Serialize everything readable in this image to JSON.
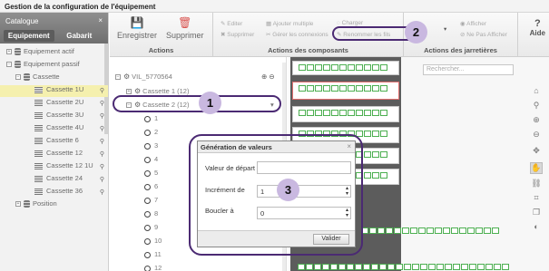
{
  "window": {
    "title": "Gestion de la configuration de l'équipement"
  },
  "catalogue": {
    "title": "Catalogue",
    "close": "×",
    "tabs": [
      "Equipement",
      "Gabarit"
    ],
    "items": [
      {
        "label": "Equipement actif",
        "level": 0
      },
      {
        "label": "Equipement passif",
        "level": 0
      },
      {
        "label": "Cassette",
        "level": 1
      },
      {
        "label": "Cassette 1U",
        "level": 2,
        "selected": true
      },
      {
        "label": "Cassette 2U",
        "level": 2
      },
      {
        "label": "Cassette 3U",
        "level": 2
      },
      {
        "label": "Cassette 4U",
        "level": 2
      },
      {
        "label": "Cassette 6",
        "level": 2
      },
      {
        "label": "Cassette 12",
        "level": 2
      },
      {
        "label": "Cassette 12 1U",
        "level": 2
      },
      {
        "label": "Cassette 24",
        "level": 2
      },
      {
        "label": "Cassette 36",
        "level": 2
      },
      {
        "label": "Position",
        "level": 1
      }
    ]
  },
  "toolbar": {
    "save": "Enregistrer",
    "delete": "Supprimer",
    "actions_title": "Actions",
    "edit": "Editer",
    "delete_small": "Supprimer",
    "add_multiple": "Ajouter multiple",
    "manage_connections": "Gérer les connexions",
    "load": "Charger",
    "rename": "Renommer les fils",
    "components_title": "Actions des composants",
    "show": "Afficher",
    "hide": "Ne Pas Afficher",
    "jumpers_title": "Actions des jarretières",
    "help": "Aide"
  },
  "tree": {
    "root": "VIL_5770564",
    "cassette1": "Cassette 1 (12)",
    "cassette2": "Cassette 2 (12)",
    "ports": [
      "1",
      "2",
      "3",
      "4",
      "5",
      "6",
      "7",
      "8",
      "9",
      "10",
      "11",
      "12"
    ]
  },
  "canvas": {
    "search_placeholder": "Rechercher..."
  },
  "dialog": {
    "title": "Génération de valeurs",
    "start_label": "Valeur de départ",
    "start_value": "",
    "increment_label": "Incrément de",
    "increment_value": "1",
    "loop_label": "Boucler à",
    "loop_value": "0",
    "submit": "Valider"
  },
  "annotations": [
    "1",
    "2",
    "3"
  ]
}
